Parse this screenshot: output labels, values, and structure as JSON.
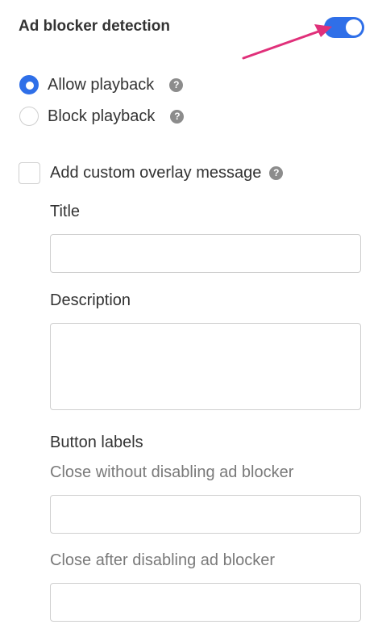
{
  "accent_color": "#2f6fe8",
  "annotation_color": "#e0307a",
  "ad_blocker": {
    "title": "Ad blocker detection",
    "enabled": true
  },
  "playback_options": [
    {
      "label": "Allow playback",
      "checked": true,
      "help_icon": "question-icon"
    },
    {
      "label": "Block playback",
      "checked": false,
      "help_icon": "question-icon"
    }
  ],
  "overlay": {
    "checkbox_label": "Add custom overlay message",
    "checked": false,
    "help_icon": "question-icon",
    "title_label": "Title",
    "title_value": "",
    "description_label": "Description",
    "description_value": "",
    "button_labels_heading": "Button labels",
    "close_without_label": "Close without disabling ad blocker",
    "close_without_value": "",
    "close_after_label": "Close after disabling ad blocker",
    "close_after_value": ""
  },
  "help_glyph": "?"
}
